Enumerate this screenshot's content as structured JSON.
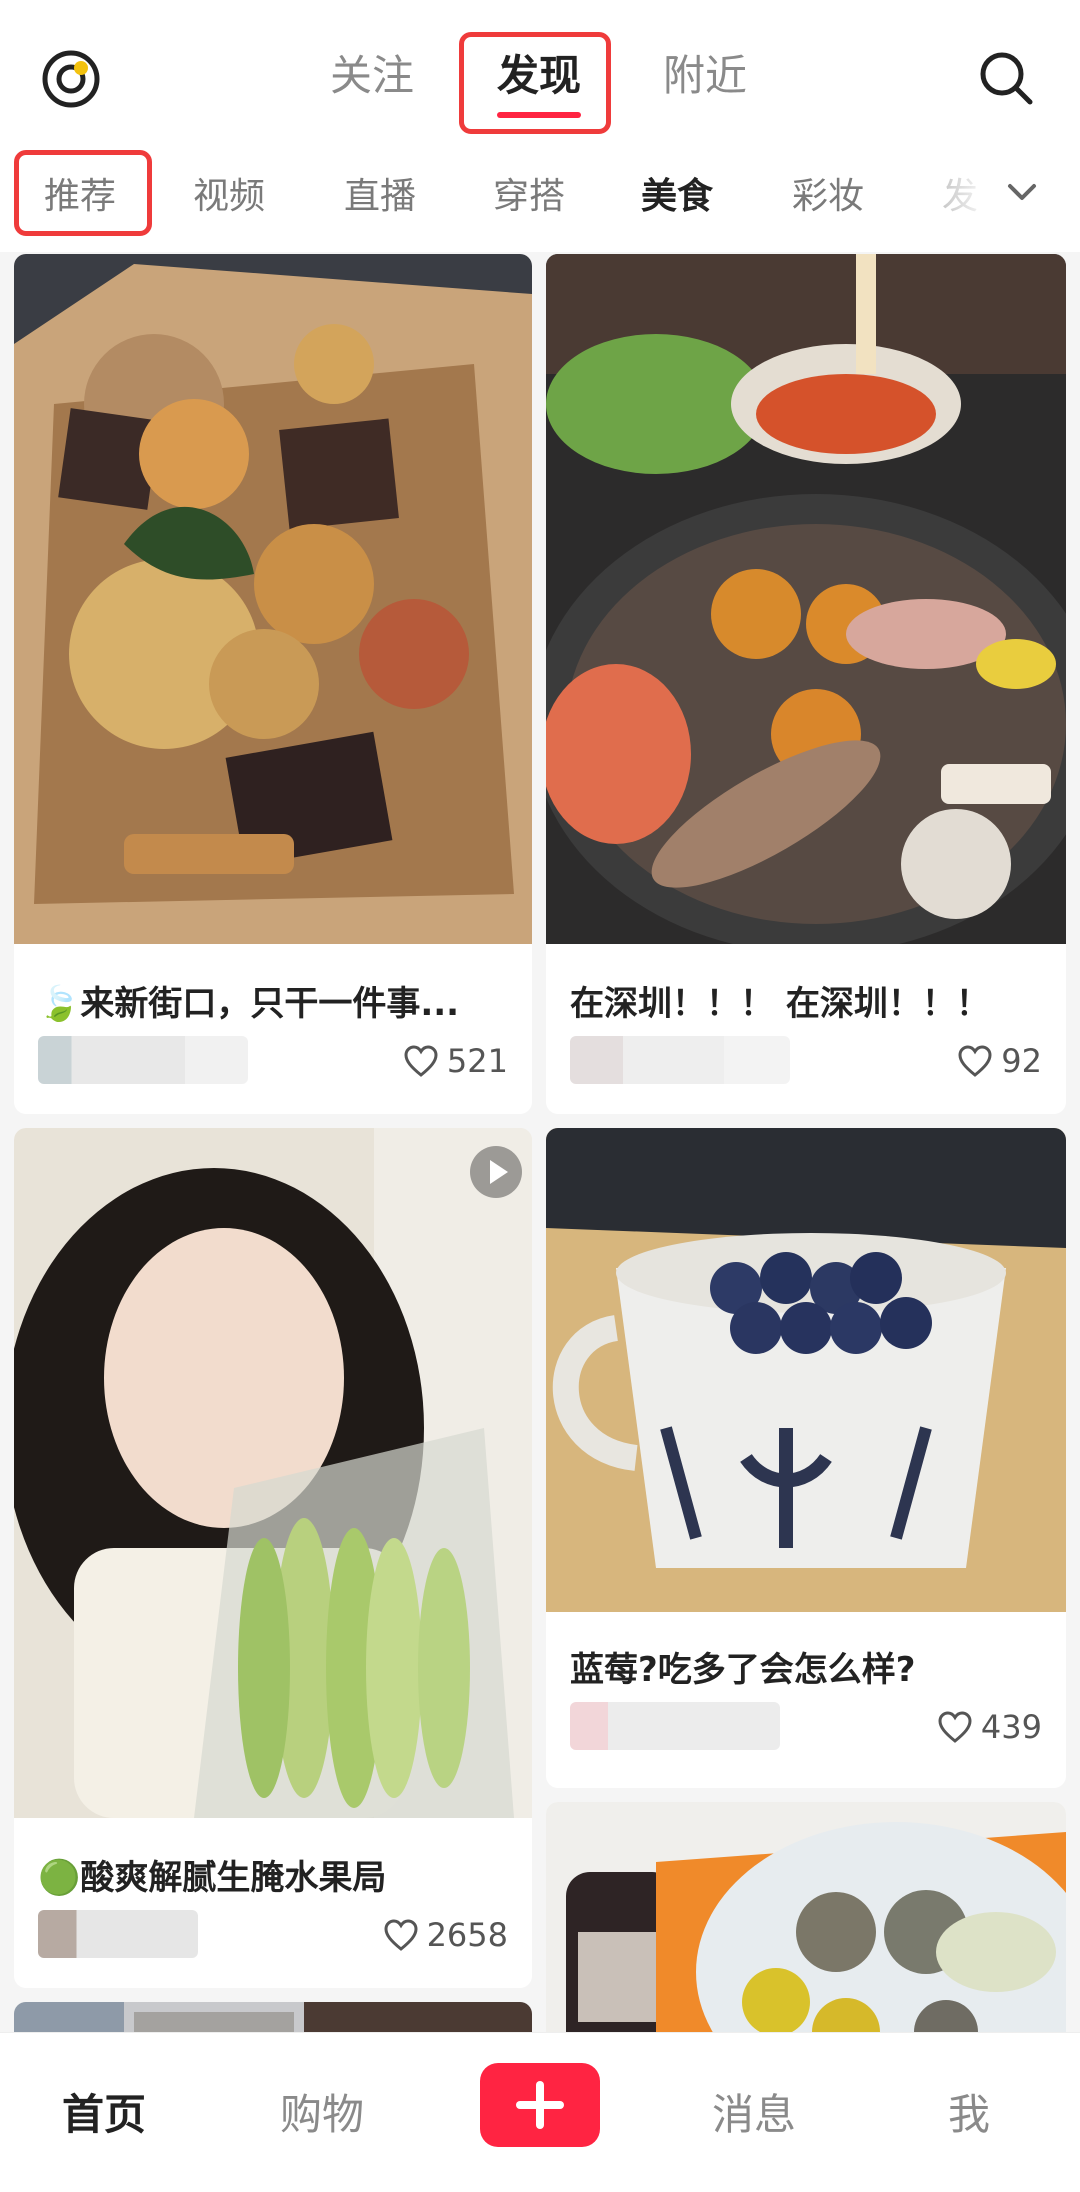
{
  "top_tabs": [
    "关注",
    "发现",
    "附近"
  ],
  "categories": [
    "推荐",
    "视频",
    "直播",
    "穿搭",
    "美食",
    "彩妆",
    "发"
  ],
  "cards": [
    {
      "title": "🍃来新街口，只干一件事...",
      "likes": "521"
    },
    {
      "title": "在深圳！！！ 在深圳！！！",
      "likes": "92"
    },
    {
      "title": "🟢酸爽解腻生腌水果局",
      "likes": "2658"
    },
    {
      "title": "蓝莓?吃多了会怎么样?",
      "likes": "439"
    }
  ],
  "bottom_nav": [
    "首页",
    "购物",
    "消息",
    "我"
  ],
  "icons": {
    "logo": "record-logo-icon",
    "search": "search-icon",
    "more": "chevron-down-icon",
    "likes": "heart-outline-icon",
    "video": "play-icon",
    "publish": "plus-icon"
  },
  "colors": {
    "accent": "#ff2442",
    "highlight_box": "#ef3b3b"
  }
}
